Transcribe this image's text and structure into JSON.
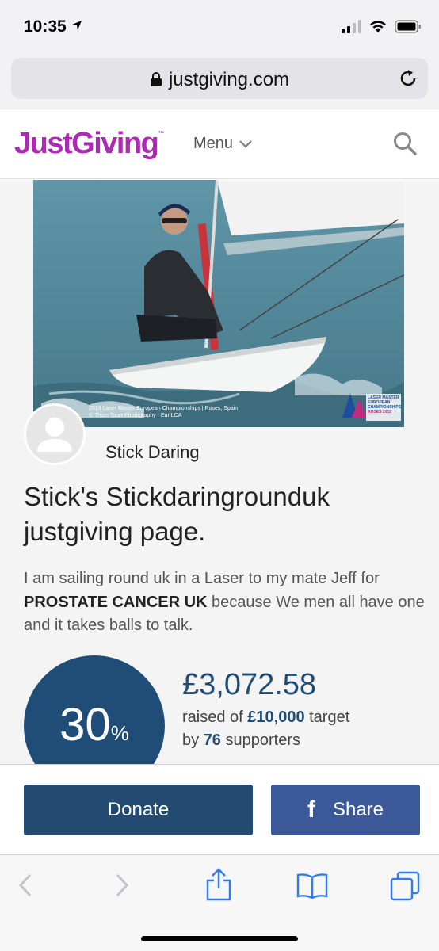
{
  "status": {
    "time": "10:35"
  },
  "browser": {
    "url": "justgiving.com"
  },
  "header": {
    "logo": "JustGiving",
    "logo_tm": "™",
    "menu_label": "Menu"
  },
  "hero": {
    "caption_line1": "2019 Laser Master European Championships | Roses, Spain",
    "caption_line2": "© Thom Touw Photography · EurILCA",
    "badge_line1": "LASER MASTER",
    "badge_line2": "EUROPEAN",
    "badge_line3": "CHAMPIONSHIPS",
    "badge_line4": "ROSES 2019"
  },
  "owner": {
    "name": "Stick Daring"
  },
  "page": {
    "title": "Stick's Stickdaringrounduk justgiving page.",
    "desc_part1": "I am sailing round uk in a Laser to my mate Jeff for ",
    "desc_charity": "PROSTATE CANCER UK",
    "desc_part2": " because We men all have one and it takes balls to talk."
  },
  "progress": {
    "percent": "30",
    "percent_sign": "%",
    "amount": "£3,072.58",
    "raised_prefix": "raised of ",
    "target": "£10,000",
    "raised_suffix": " target",
    "by_prefix": "by ",
    "supporters": "76",
    "supporters_suffix": " supporters"
  },
  "actions": {
    "donate_label": "Donate",
    "share_label": "Share",
    "share_icon": "f"
  },
  "colors": {
    "brand": "#ad29b6",
    "navy": "#1f4d77",
    "facebook": "#3b5998"
  }
}
